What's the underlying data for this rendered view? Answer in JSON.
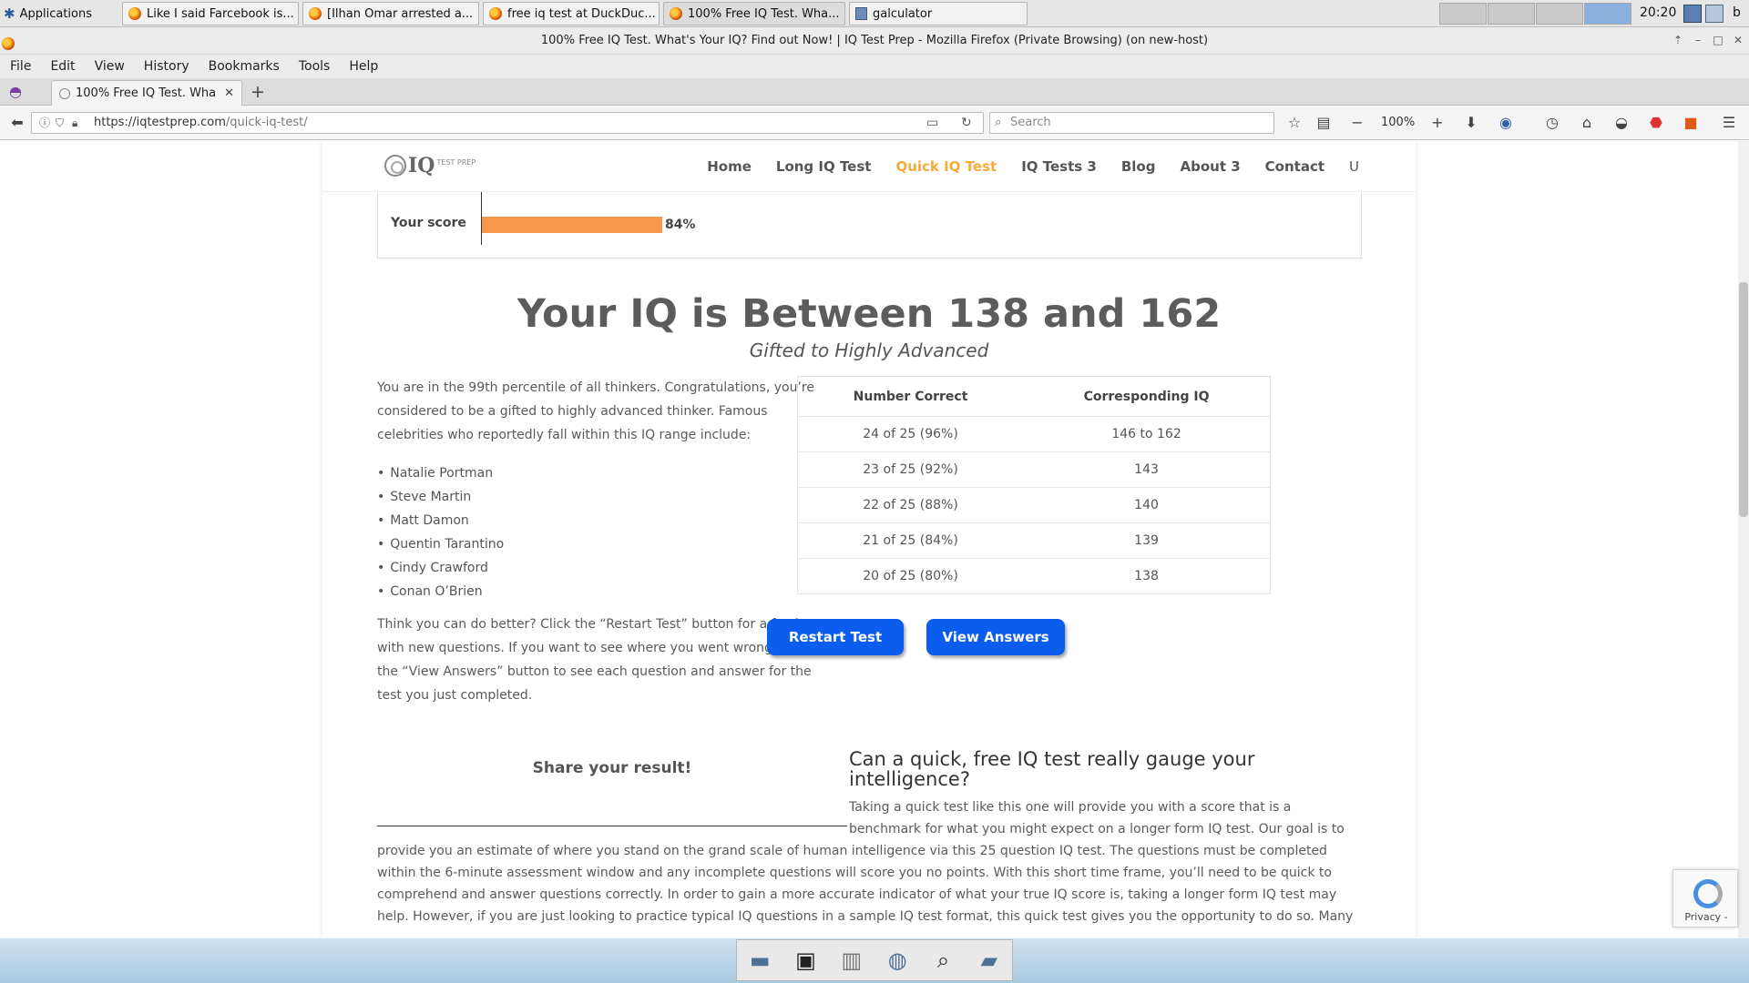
{
  "taskbar": {
    "apps_label": "Applications",
    "tasks": [
      {
        "label": "Like I said Farcebook is..."
      },
      {
        "label": "[Ilhan Omar arrested a..."
      },
      {
        "label": "free iq test at DuckDuc..."
      },
      {
        "label": "100% Free IQ Test. Wha..."
      },
      {
        "label": "galculator"
      }
    ],
    "clock": "20:20",
    "user_initial": "b"
  },
  "window": {
    "title": "100% Free IQ Test. What's Your IQ? Find out Now! | IQ Test Prep - Mozilla Firefox (Private Browsing) (on new-host)"
  },
  "menubar": [
    "File",
    "Edit",
    "View",
    "History",
    "Bookmarks",
    "Tools",
    "Help"
  ],
  "tab": {
    "label": "100% Free IQ Test. Wha"
  },
  "navbar": {
    "url_host": "https://iqtestprep.com",
    "url_path": "/quick-iq-test/",
    "search_placeholder": "Search",
    "zoom": "100%"
  },
  "site": {
    "logo_text": "IQ",
    "logo_sub": "TEST PREP",
    "nav": [
      "Home",
      "Long IQ Test",
      "Quick IQ Test",
      "IQ Tests 3",
      "Blog",
      "About 3",
      "Contact"
    ],
    "nav_extra": "U"
  },
  "score": {
    "label": "Your score",
    "value": 84,
    "value_text": "84%"
  },
  "result": {
    "title": "Your IQ is Between 138 and 162",
    "subtitle": "Gifted to Highly Advanced",
    "intro": "You are in the 99th percentile of all thinkers. Congratulations, you’re considered to be a gifted to highly advanced thinker. Famous celebrities who reportedly fall within this IQ range include:",
    "celebrities": [
      "Natalie Portman",
      "Steve Martin",
      "Matt Damon",
      "Quentin Tarantino",
      "Cindy Crawford",
      "Conan O’Brien"
    ],
    "restart_text": "Think you can do better? Click the “Restart Test” button for a fresh test with new questions. If you want to see where you went wrong, click on the “View Answers” button to see each question and answer for the test you just completed."
  },
  "iq_table": {
    "headers": [
      "Number Correct",
      "Corresponding IQ"
    ],
    "rows": [
      [
        "24 of 25 (96%)",
        "146 to 162"
      ],
      [
        "23 of 25 (92%)",
        "143"
      ],
      [
        "22 of 25 (88%)",
        "140"
      ],
      [
        "21 of 25 (84%)",
        "139"
      ],
      [
        "20 of 25 (80%)",
        "138"
      ]
    ]
  },
  "buttons": {
    "restart": "Restart Test",
    "view_answers": "View Answers"
  },
  "share": {
    "title": "Share your result!"
  },
  "article": {
    "title": "Can a quick, free IQ test really gauge your intelligence?",
    "lines_right": [
      "Taking a quick test like this one will provide you with a score that is a",
      "benchmark for what you might expect on a longer form IQ test. Our goal is to"
    ],
    "lines_full": [
      "provide you an estimate of where you stand on the grand scale of human intelligence via this 25 question IQ test. The questions must be completed",
      "within the 6-minute assessment window and any incomplete questions will score you no points. With this short time frame, you’ll need to be quick to",
      "comprehend and answer questions correctly. In order to gain a more accurate indicator of what your true IQ score is, taking a longer form IQ test may",
      "help. However, if you are just looking to practice typical IQ questions in a sample IQ test format, this quick test gives you the opportunity to do so. Many"
    ]
  },
  "recaptcha": {
    "label": "Privacy -"
  },
  "colors": {
    "accent_orange": "#f7a93a",
    "score_bar": "#f7974a",
    "button_blue": "#0b5df0"
  }
}
